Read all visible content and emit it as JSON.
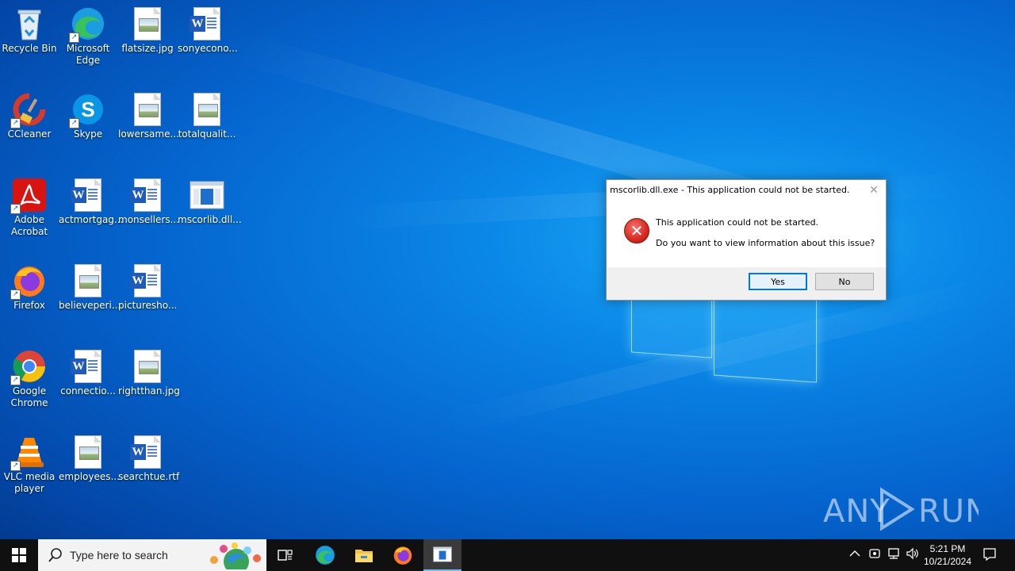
{
  "desktop": {
    "icons": [
      {
        "label": "Recycle Bin",
        "icon": "recycle-bin-icon"
      },
      {
        "label": "Microsoft Edge",
        "icon": "edge-icon"
      },
      {
        "label": "flatsize.jpg",
        "icon": "image-file-icon"
      },
      {
        "label": "sonyecono...",
        "icon": "word-document-icon"
      },
      {
        "label": "CCleaner",
        "icon": "ccleaner-icon"
      },
      {
        "label": "Skype",
        "icon": "skype-icon"
      },
      {
        "label": "lowersame...",
        "icon": "image-file-icon"
      },
      {
        "label": "totalqualit...",
        "icon": "image-file-icon"
      },
      {
        "label": "Adobe Acrobat",
        "icon": "acrobat-icon"
      },
      {
        "label": "actmortgag...",
        "icon": "word-document-icon"
      },
      {
        "label": "monsellers...",
        "icon": "word-document-icon"
      },
      {
        "label": "mscorlib.dll...",
        "icon": "application-icon"
      },
      {
        "label": "Firefox",
        "icon": "firefox-icon"
      },
      {
        "label": "believeperi...",
        "icon": "image-file-icon"
      },
      {
        "label": "picturesho...",
        "icon": "word-document-icon"
      },
      {
        "label": "Google Chrome",
        "icon": "chrome-icon"
      },
      {
        "label": "connectio...",
        "icon": "word-document-icon"
      },
      {
        "label": "rightthan.jpg",
        "icon": "image-file-icon"
      },
      {
        "label": "VLC media player",
        "icon": "vlc-icon"
      },
      {
        "label": "employees...",
        "icon": "image-file-icon"
      },
      {
        "label": "searchtue.rtf",
        "icon": "word-document-icon"
      }
    ]
  },
  "dialog": {
    "title": "mscorlib.dll.exe - This application could not be started.",
    "close": "✕",
    "icon": "error-icon",
    "message_line1": "This application could not be started.",
    "message_line2": "Do you want to view information about this issue?",
    "yes_label": "Yes",
    "no_label": "No"
  },
  "watermark": "ANY RUN",
  "taskbar": {
    "search_placeholder": "Type here to search",
    "time": "5:21 PM",
    "date": "10/21/2024",
    "accent": "#76b9ed"
  }
}
